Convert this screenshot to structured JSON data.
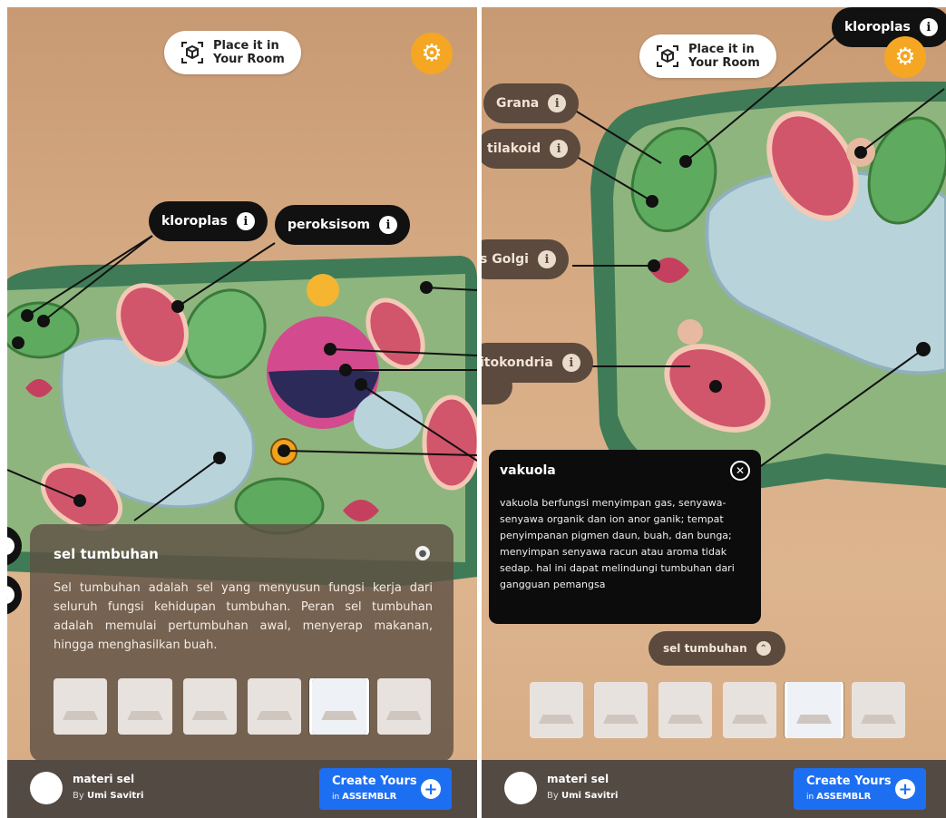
{
  "left": {
    "place_button": {
      "line1": "Place it in",
      "line2": "Your Room"
    },
    "labels": {
      "kloroplas": "kloroplas",
      "peroksisom": "peroksisom"
    },
    "sheet": {
      "title": "sel tumbuhan",
      "body": "Sel tumbuhan adalah sel yang menyusun fungsi kerja dari seluruh fungsi kehidupan tumbuhan. Peran sel tumbuhan adalah memulai pertumbuhan awal, menyerap makanan, hingga menghasilkan buah."
    },
    "footer": {
      "title": "materi sel",
      "by_prefix": "By",
      "author": "Umi Savitri",
      "create_line1": "Create Yours",
      "create_prefix": "in",
      "create_brand": "ASSEMBLR"
    }
  },
  "right": {
    "place_button": {
      "line1": "Place it in",
      "line2": "Your Room"
    },
    "labels": {
      "kloroplas": "kloroplas",
      "grana": "Grana",
      "tilakoid": "tilakoid",
      "golgi": "s Golgi",
      "mitokondria": "itokondria"
    },
    "popup": {
      "title": "vakuola",
      "body": "vakuola berfungsi menyimpan gas, senyawa-senyawa organik dan ion anor ganik; tempat penyimpanan pigmen daun, buah, dan bunga; menyimpan senyawa racun atau aroma tidak sedap. hal ini dapat melindungi tumbuhan dari gangguan pemangsa"
    },
    "chip": "sel tumbuhan",
    "footer": {
      "title": "materi sel",
      "by_prefix": "By",
      "author": "Umi Savitri",
      "create_line1": "Create Yours",
      "create_prefix": "in",
      "create_brand": "ASSEMBLR"
    }
  },
  "icons": {
    "ar": "ar-cube-icon",
    "settings": "gear-icon",
    "info": "info-icon",
    "close": "close-icon",
    "collapse": "chevron-up-icon",
    "add": "plus-icon"
  },
  "colors": {
    "accent": "#f5a623",
    "brand": "#1d6ff2",
    "label_bg": "#111111",
    "footer_bg": "#544a44"
  }
}
